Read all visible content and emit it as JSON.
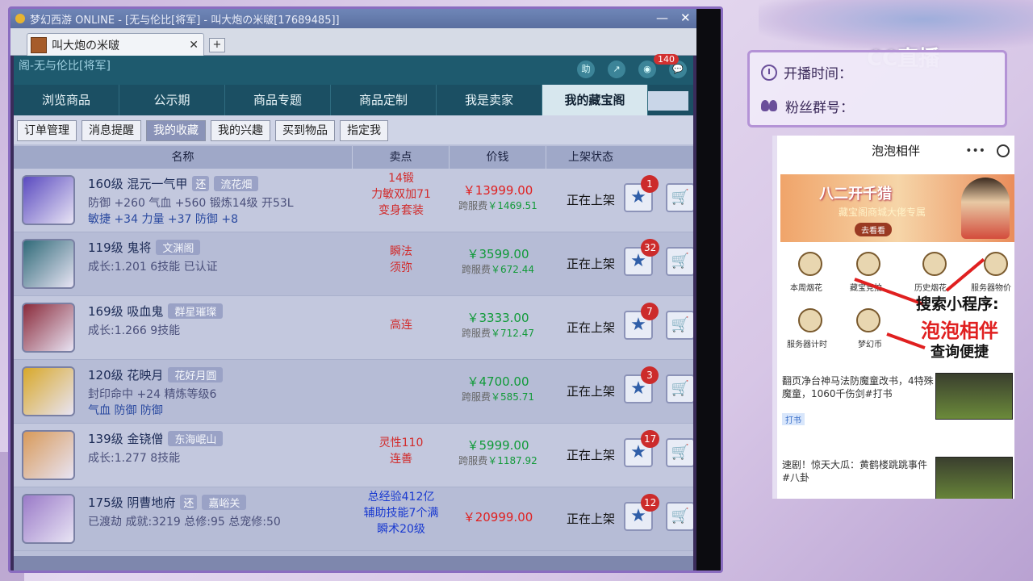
{
  "window": {
    "title": "梦幻西游 ONLINE - [无与伦比[将军] - 叫大炮の米啵[17689485]]",
    "minimize": "—",
    "close": "✕"
  },
  "browser": {
    "tab_label": "叫大炮の米啵",
    "tab_close": "✕",
    "tab_add": "+"
  },
  "page": {
    "header_title": "阁-无与伦比[将军]",
    "header_icons": [
      "助",
      "↗",
      "◉",
      "💬"
    ],
    "message_count": "140",
    "main_tabs": [
      {
        "label": "浏览商品"
      },
      {
        "label": "公示期"
      },
      {
        "label": "商品专题"
      },
      {
        "label": "商品定制"
      },
      {
        "label": "我是卖家"
      },
      {
        "label": "我的藏宝阁"
      }
    ],
    "sub_tabs": [
      {
        "label": "订单管理"
      },
      {
        "label": "消息提醒"
      },
      {
        "label": "我的收藏"
      },
      {
        "label": "我的兴趣"
      },
      {
        "label": "买到物品"
      },
      {
        "label": "指定我"
      }
    ],
    "columns": [
      "名称",
      "卖点",
      "价钱",
      "上架状态"
    ],
    "rows": [
      {
        "level_name": "160级 混元一气甲",
        "tag_small": "还",
        "tag": "流花畑",
        "line2": "防御 +260 气血 +560 锻炼14级 开53L",
        "line3": "敏捷 +34 力量 +37 防御 +8",
        "sell1": "14锻",
        "sell2": "力敏双加71",
        "sell3": "变身套装",
        "price": "￥13999.00",
        "fee_label": "跨服费",
        "fee": "￥1469.51",
        "status": "正在上架",
        "fav_count": "1",
        "sell_color": "#d22a2a",
        "price_color": "#e02020",
        "thumb_color": "#5a4ac0"
      },
      {
        "level_name": "119级 鬼将",
        "tag": "文渊阁",
        "line2": "成长:1.201 6技能 已认证",
        "sell1": "瞬法",
        "sell2": "须弥",
        "price": "￥3599.00",
        "fee_label": "跨服费",
        "fee": "￥672.44",
        "status": "正在上架",
        "fav_count": "32",
        "sell_color": "#d22a2a",
        "price_color": "#0f9a38",
        "thumb_color": "#2f6a78"
      },
      {
        "level_name": "169级 吸血鬼",
        "tag": "群星璀璨",
        "line2": "成长:1.266 9技能",
        "sell1": "高连",
        "price": "￥3333.00",
        "fee_label": "跨服费",
        "fee": "￥712.47",
        "status": "正在上架",
        "fav_count": "7",
        "sell_color": "#d22a2a",
        "price_color": "#0f9a38",
        "thumb_color": "#8a2a3a"
      },
      {
        "level_name": "120级 花映月",
        "tag": "花好月圆",
        "line2": "封印命中 +24 精炼等级6",
        "line3": "气血 防御 防御",
        "price": "￥4700.00",
        "fee_label": "跨服费",
        "fee": "￥585.71",
        "status": "正在上架",
        "fav_count": "3",
        "sell_color": "#d22a2a",
        "price_color": "#0f9a38",
        "thumb_color": "#d8a82a"
      },
      {
        "level_name": "139级 金铙僧",
        "tag": "东海岷山",
        "line2": "成长:1.277 8技能",
        "sell1": "灵性110",
        "sell2": "连善",
        "price": "￥5999.00",
        "fee_label": "跨服费",
        "fee": "￥1187.92",
        "status": "正在上架",
        "fav_count": "17",
        "sell_color": "#d22a2a",
        "price_color": "#0f9a38",
        "thumb_color": "#d89a5a"
      },
      {
        "level_name": "175级 阴曹地府",
        "tag_small": "还",
        "tag": "嘉峪关",
        "line2": "已渡劫 成就:3219 总修:95 总宠修:50",
        "sell1": "总经验412亿",
        "sell2": "辅助技能7个满",
        "sell3": "瞬术20级",
        "price": "￥20999.00",
        "status": "正在上架",
        "fav_count": "12",
        "sell_color": "#1a3ad0",
        "price_color": "#e02020",
        "thumb_color": "#9a7ac8"
      }
    ]
  },
  "overlay": {
    "live_time_label": "开播时间：",
    "fan_group_label": "粉丝群号：",
    "cc_logo": "CC直播",
    "phone_title": "泡泡相伴",
    "phone_dots": "•••",
    "banner_title": "八二开千猎",
    "banner_sub": "藏宝阁商城大佬专属",
    "banner_btn": "去看看",
    "mini_items": [
      "本周烟花",
      "藏宝竞拍",
      "历史烟花",
      "服务器物价",
      "服务器计时",
      "梦幻币"
    ],
    "promo1": "搜索小程序:",
    "promo2": "泡泡相伴",
    "promo3": "查询便捷",
    "news1": "翻页净台神马法防魔童改书，4特殊魔童，1060千伤剑#打书",
    "news1_tag": "打书",
    "news2": "速剧！惊天大瓜：黄鹤楼跳跳事件#八卦"
  }
}
